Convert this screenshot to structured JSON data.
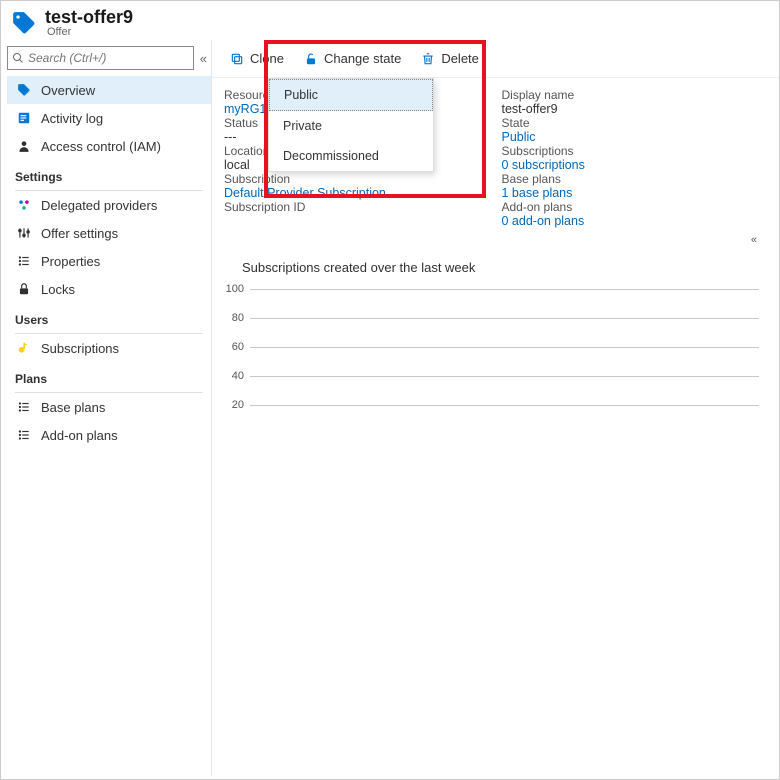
{
  "header": {
    "title": "test-offer9",
    "subtitle": "Offer"
  },
  "search": {
    "placeholder": "Search (Ctrl+/)"
  },
  "nav": {
    "main": [
      {
        "label": "Overview"
      },
      {
        "label": "Activity log"
      },
      {
        "label": "Access control (IAM)"
      }
    ],
    "sections": {
      "settings": "Settings",
      "settings_items": [
        {
          "label": "Delegated providers"
        },
        {
          "label": "Offer settings"
        },
        {
          "label": "Properties"
        },
        {
          "label": "Locks"
        }
      ],
      "users": "Users",
      "users_items": [
        {
          "label": "Subscriptions"
        }
      ],
      "plans": "Plans",
      "plans_items": [
        {
          "label": "Base plans"
        },
        {
          "label": "Add-on plans"
        }
      ]
    }
  },
  "toolbar": {
    "clone": "Clone",
    "change_state": "Change state",
    "delete": "Delete",
    "state_options": {
      "public": "Public",
      "private": "Private",
      "decom": "Decommissioned"
    }
  },
  "fields": {
    "resource_group_l": "Resource group",
    "resource_group_v": "myRG1",
    "status_l": "Status",
    "status_v": "---",
    "location_l": "Location",
    "location_v": "local",
    "subscription_l": "Subscription",
    "subscription_v": "Default Provider Subscription",
    "subscription_id_l": "Subscription ID",
    "display_name_l": "Display name",
    "display_name_v": "test-offer9",
    "state_l": "State",
    "state_v": "Public",
    "subs_l": "Subscriptions",
    "subs_v": "0 subscriptions",
    "base_l": "Base plans",
    "base_v": "1 base plans",
    "addon_l": "Add-on plans",
    "addon_v": "0 add-on plans"
  },
  "chart_data": {
    "type": "line",
    "title": "Subscriptions created over the last week",
    "xlabel": "",
    "ylabel": "",
    "ylim": [
      0,
      100
    ],
    "yticks": [
      100,
      80,
      60,
      40,
      20
    ],
    "categories": [],
    "values": []
  }
}
